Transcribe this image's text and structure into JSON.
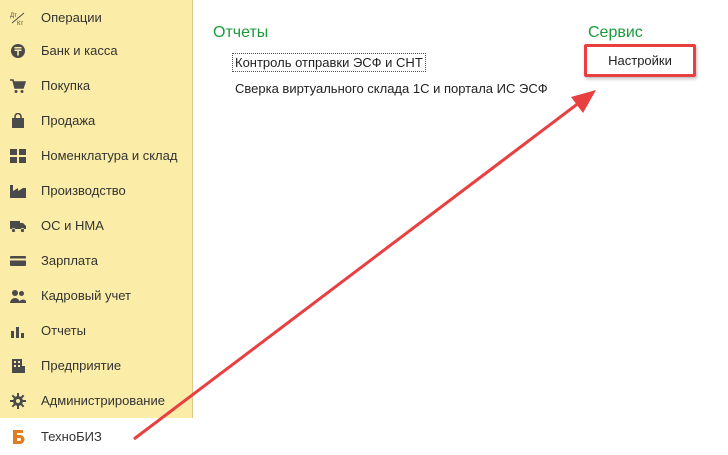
{
  "sidebar": {
    "items": [
      {
        "label": "Операции",
        "icon": "dt-kt-icon"
      },
      {
        "label": "Банк и касса",
        "icon": "tenge-coin-icon"
      },
      {
        "label": "Покупка",
        "icon": "cart-icon"
      },
      {
        "label": "Продажа",
        "icon": "shopping-bag-icon"
      },
      {
        "label": "Номенклатура и склад",
        "icon": "grid-blocks-icon"
      },
      {
        "label": "Производство",
        "icon": "factory-icon"
      },
      {
        "label": "ОС и НМА",
        "icon": "truck-icon"
      },
      {
        "label": "Зарплата",
        "icon": "card-icon"
      },
      {
        "label": "Кадровый учет",
        "icon": "people-icon"
      },
      {
        "label": "Отчеты",
        "icon": "bar-chart-icon"
      },
      {
        "label": "Предприятие",
        "icon": "building-icon"
      },
      {
        "label": "Администрирование",
        "icon": "gear-icon"
      },
      {
        "label": "ТехноБИЗ",
        "icon": "technobiz-logo-icon",
        "active": true
      }
    ],
    "dt_kt_text": {
      "top": "Дт",
      "bottom": "Кт"
    }
  },
  "main": {
    "reports": {
      "title": "Отчеты",
      "links": [
        "Контроль отправки ЭСФ и СНТ",
        "Сверка виртуального склада 1С и портала ИС ЭСФ"
      ]
    },
    "service": {
      "title": "Сервис",
      "links": [
        "Настройки"
      ]
    }
  },
  "colors": {
    "sidebar_bg": "#fbeda7",
    "section_title": "#1a9b3c",
    "highlight": "#e84040",
    "icon": "#4a4a4a"
  }
}
